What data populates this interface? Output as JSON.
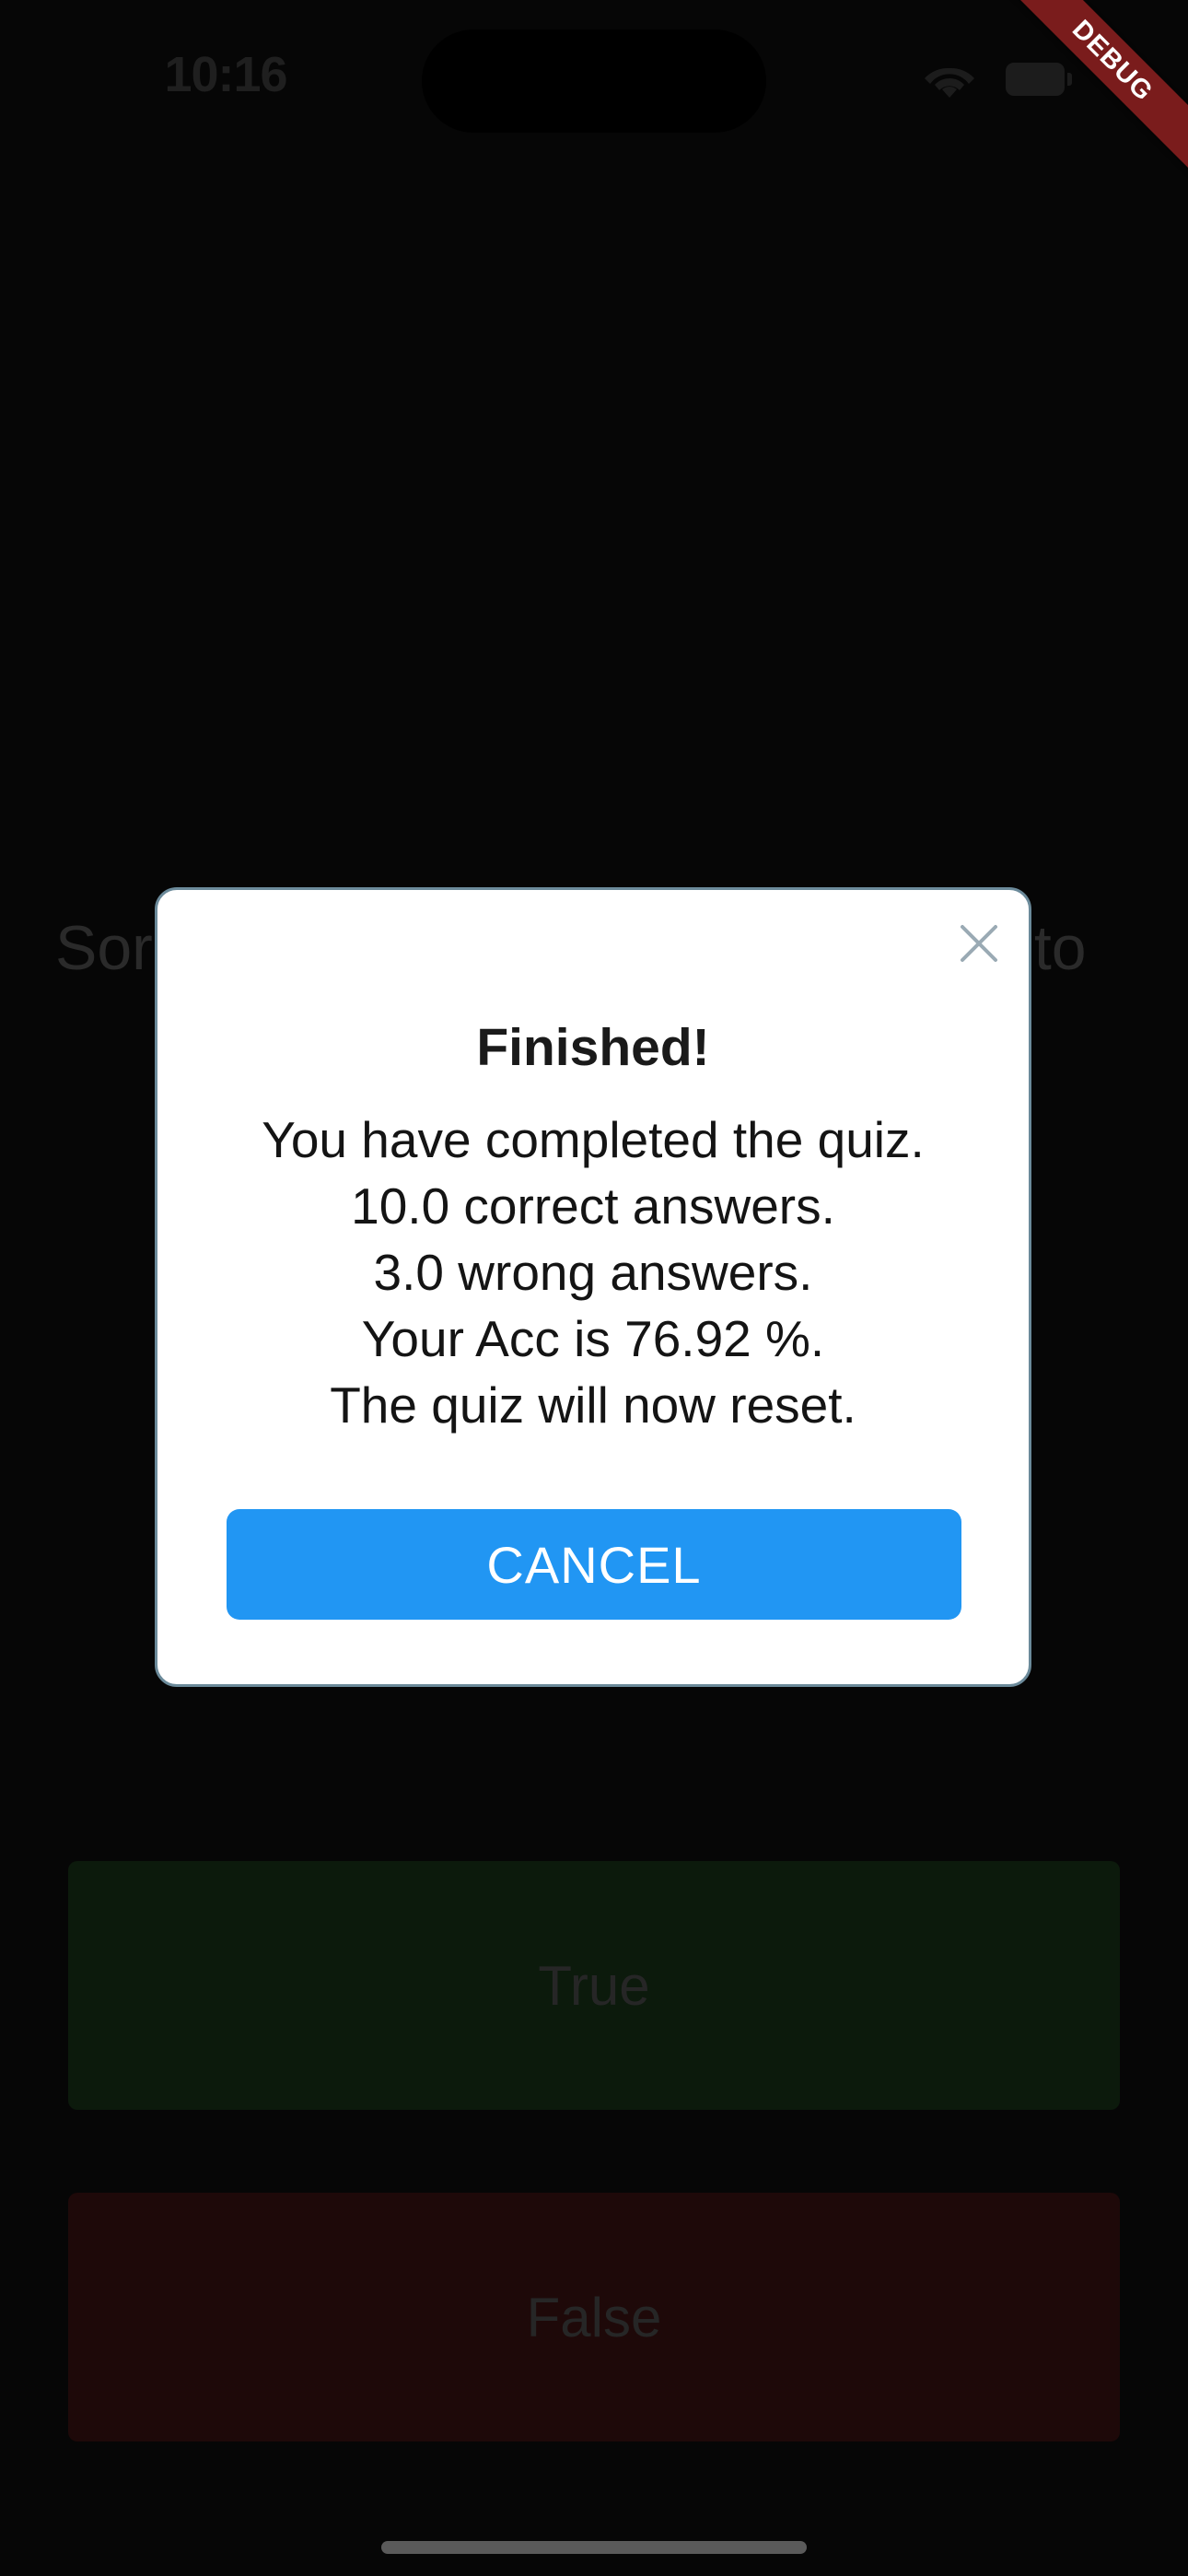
{
  "status_bar": {
    "time": "10:16",
    "icons": [
      "wifi-icon",
      "battery-icon"
    ]
  },
  "debug_banner": {
    "label": "DEBUG",
    "color": "#7a1c1c"
  },
  "quiz": {
    "question_visible_left": "Sor",
    "question_visible_right": "c to",
    "true_label": "True",
    "false_label": "False",
    "true_color": "#0c1a0c",
    "false_color": "#1e0909"
  },
  "dialog": {
    "title": "Finished!",
    "lines": [
      "You have completed the quiz.",
      "10.0  correct answers.",
      "3.0 wrong answers.",
      "Your Acc is 76.92 %.",
      "The quiz will now reset."
    ],
    "cancel_label": "CANCEL",
    "cancel_color": "#2196f3",
    "close_icon": "close-icon"
  }
}
